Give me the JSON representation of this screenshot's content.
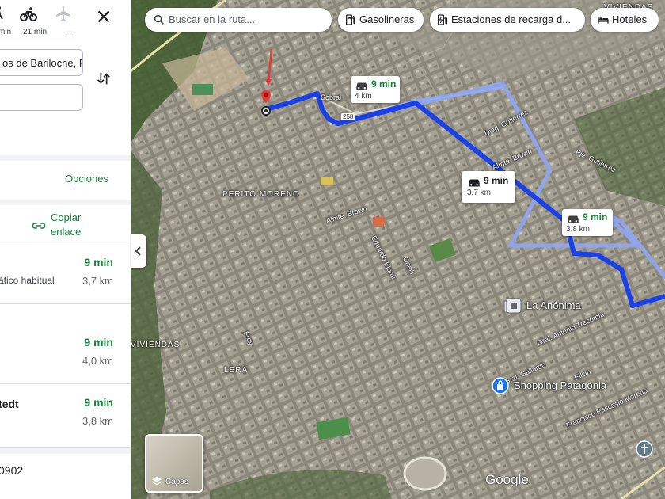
{
  "panel": {
    "modes": [
      {
        "name": "walk",
        "time": "min"
      },
      {
        "name": "bike",
        "time": "21 min"
      },
      {
        "name": "flight",
        "time": "—"
      }
    ],
    "origin_value": "os de Bariloche, F",
    "destination_value": "",
    "options_label": "Opciones",
    "copy_link_label": "Copiar enlace",
    "routes": [
      {
        "name": "",
        "description": "áfico habitual",
        "time": "9 min",
        "distance": "3,7 km"
      },
      {
        "name": "",
        "description": "",
        "time": "9 min",
        "distance": "4,0 km"
      },
      {
        "name": "tedt",
        "description": "",
        "time": "9 min",
        "distance": "3,8 km"
      }
    ],
    "bottom_text": "0902"
  },
  "map": {
    "search_placeholder": "Buscar en la ruta...",
    "chips": [
      "Gasolineras",
      "Estaciones de recarga d...",
      "Hoteles"
    ],
    "bubbles": [
      {
        "time": "9 min",
        "distance": "4 km",
        "selected": false
      },
      {
        "time": "9 min",
        "distance": "3,7 km",
        "selected": true
      },
      {
        "time": "9 min",
        "distance": "3,8 km",
        "selected": false
      }
    ],
    "labels": [
      "PERITO MORENO",
      "VIVIENDAS",
      "LERA",
      "VIVIENDAS"
    ],
    "pois": [
      "La Anónima",
      "Shopping Patagonia"
    ],
    "streets": [
      "Sobral",
      "Diag. Gutiérrez",
      "Almte. Brown",
      "Pje. Gutiérrez",
      "Eduardo Elordi",
      "Onelli",
      "Gral. Antonio Trecomia",
      "Gral. Gallardo",
      "Frey",
      "Ellcin",
      "Francisco Pascasio Moreno",
      "Almte. Brown",
      "258"
    ],
    "layers_label": "Capas",
    "google_label": "Google",
    "colors": {
      "route": "#1a40e8",
      "alt_route": "#8ea6f5",
      "green": "#188038"
    }
  }
}
